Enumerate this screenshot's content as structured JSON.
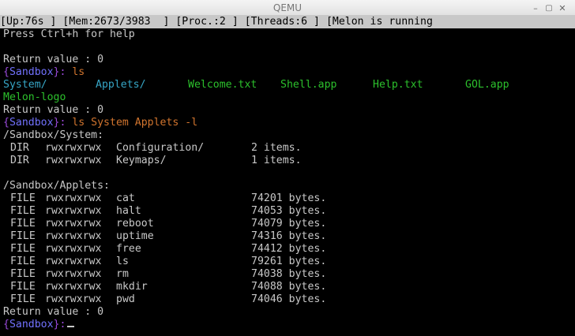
{
  "window": {
    "title": "QEMU",
    "minimize": "–",
    "maximize": "▢",
    "close": "✕"
  },
  "status_bar": {
    "uptime": "[Up:76s ]",
    "mem": "[Mem:2673/3983  ]",
    "proc": "[Proc.:2 ]",
    "threads": "[Threads:6 ]",
    "status": "[Melon is running"
  },
  "terminal": {
    "help": "Press Ctrl+h for help",
    "return_value": "Return value : 0",
    "prompt_open": "{",
    "prompt_name": "Sandbox",
    "prompt_close": "}:",
    "cmd_ls": " ls",
    "cmd_ls_long": " ls System Applets -l",
    "ls_entries": [
      "System/",
      "Applets/",
      "Welcome.txt",
      "Shell.app",
      "Help.txt",
      "GOL.app",
      "Melon-logo"
    ],
    "system_header": "/Sandbox/System:",
    "system_rows": [
      {
        "type": "DIR",
        "perm": "rwxrwxrwx",
        "name": "Configuration/",
        "size": "2 items."
      },
      {
        "type": "DIR",
        "perm": "rwxrwxrwx",
        "name": "Keymaps/",
        "size": "1 items."
      }
    ],
    "applets_header": "/Sandbox/Applets:",
    "applet_rows": [
      {
        "type": "FILE",
        "perm": "rwxrwxrwx",
        "name": "cat",
        "size": "74201 bytes."
      },
      {
        "type": "FILE",
        "perm": "rwxrwxrwx",
        "name": "halt",
        "size": "74053 bytes."
      },
      {
        "type": "FILE",
        "perm": "rwxrwxrwx",
        "name": "reboot",
        "size": "74079 bytes."
      },
      {
        "type": "FILE",
        "perm": "rwxrwxrwx",
        "name": "uptime",
        "size": "74316 bytes."
      },
      {
        "type": "FILE",
        "perm": "rwxrwxrwx",
        "name": "free",
        "size": "74412 bytes."
      },
      {
        "type": "FILE",
        "perm": "rwxrwxrwx",
        "name": "ls",
        "size": "79261 bytes."
      },
      {
        "type": "FILE",
        "perm": "rwxrwxrwx",
        "name": "rm",
        "size": "74038 bytes."
      },
      {
        "type": "FILE",
        "perm": "rwxrwxrwx",
        "name": "mkdir",
        "size": "74088 bytes."
      },
      {
        "type": "FILE",
        "perm": "rwxrwxrwx",
        "name": "pwd",
        "size": "74046 bytes."
      }
    ]
  }
}
